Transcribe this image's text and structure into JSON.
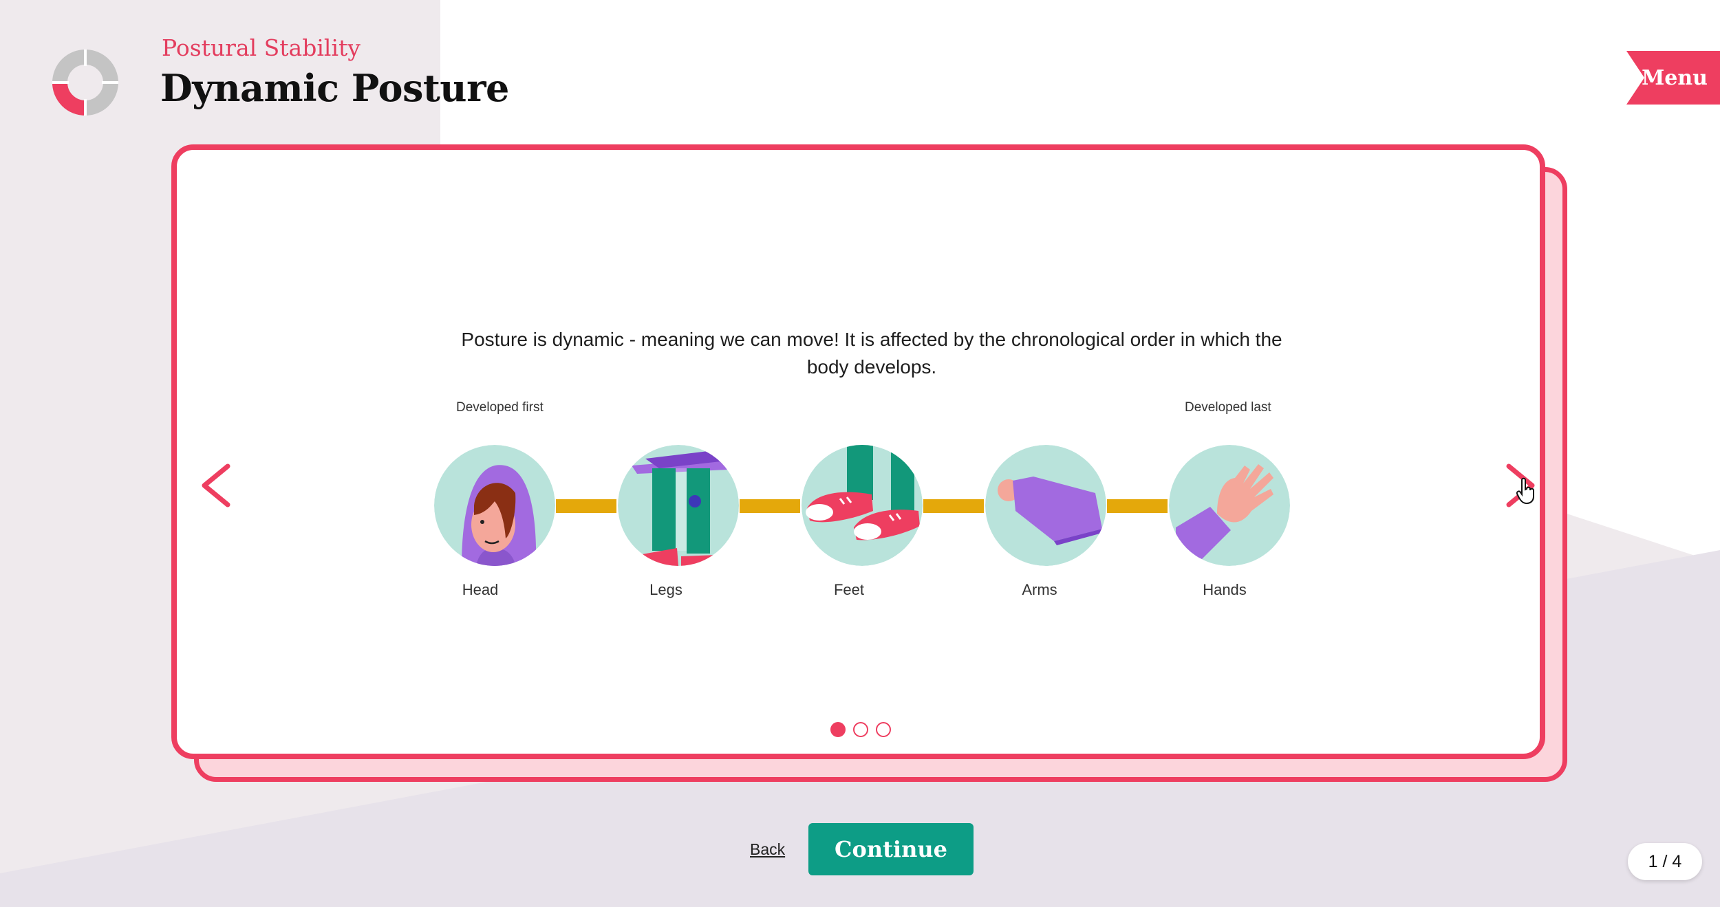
{
  "header": {
    "eyebrow": "Postural Stability",
    "title": "Dynamic Posture",
    "menu_label": "Menu"
  },
  "progress_ring": {
    "segments": 4,
    "completed": 1
  },
  "card": {
    "intro": "Posture is dynamic - meaning we can move! It is affected by the chronological order in which the body develops.",
    "label_first": "Developed first",
    "label_last": "Developed last",
    "steps": [
      {
        "label": "Head",
        "icon": "head-icon"
      },
      {
        "label": "Legs",
        "icon": "legs-icon"
      },
      {
        "label": "Feet",
        "icon": "feet-icon"
      },
      {
        "label": "Arms",
        "icon": "arms-icon"
      },
      {
        "label": "Hands",
        "icon": "hands-icon"
      }
    ],
    "carousel": {
      "total": 3,
      "active": 1
    }
  },
  "footer": {
    "back_label": "Back",
    "continue_label": "Continue",
    "page_counter": "1 / 4"
  },
  "colors": {
    "accent": "#ee3e60",
    "primary_button": "#0d9d86",
    "connector": "#e4a80b",
    "icon_bg": "#b9e3db",
    "illustration_purple": "#a26ae0",
    "illustration_green": "#12987a"
  }
}
